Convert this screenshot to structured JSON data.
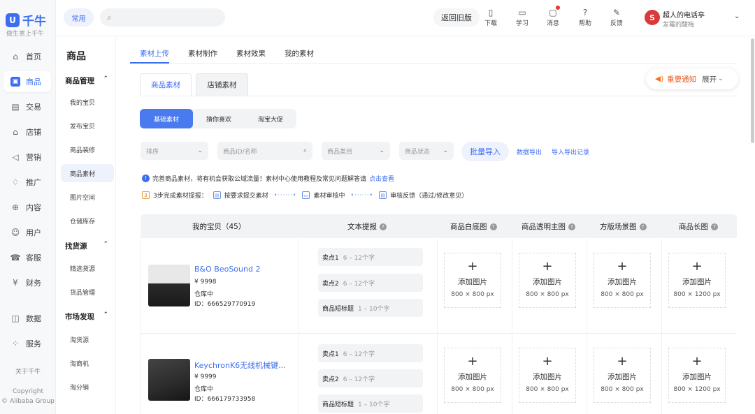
{
  "brand": {
    "name": "千牛",
    "slogan": "做生意上千牛"
  },
  "rail": [
    {
      "label": "首页",
      "icon": "home-icon"
    },
    {
      "label": "商品",
      "icon": "goods-icon",
      "active": true
    },
    {
      "label": "交易",
      "icon": "trade-icon"
    },
    {
      "label": "店铺",
      "icon": "shop-icon"
    },
    {
      "label": "营销",
      "icon": "marketing-icon"
    },
    {
      "label": "推广",
      "icon": "promote-icon"
    },
    {
      "label": "内容",
      "icon": "content-icon"
    },
    {
      "label": "用户",
      "icon": "user-icon"
    },
    {
      "label": "客服",
      "icon": "service-icon"
    },
    {
      "label": "财务",
      "icon": "finance-icon"
    },
    {
      "label": "数据",
      "icon": "data-icon"
    },
    {
      "label": "服务",
      "icon": "services-grid-icon"
    }
  ],
  "rail_footer": {
    "about": "关于千牛",
    "copyright": "Copyright",
    "company": "© Alibaba Group"
  },
  "topbar": {
    "common": "常用",
    "search_placeholder": "",
    "old_version": "返回旧版",
    "tools": [
      "下载",
      "学习",
      "消息",
      "帮助",
      "反馈"
    ],
    "user_name": "超人的电话亭",
    "user_sub": "发霉的酸梅",
    "avatar_text": "S"
  },
  "side2": {
    "title": "商品",
    "groups": [
      {
        "label": "商品管理",
        "items": [
          "我的宝贝",
          "发布宝贝",
          "商品装修",
          "商品素材",
          "图片空间",
          "仓储库存"
        ]
      },
      {
        "label": "找货源",
        "items": [
          "精选货源",
          "货品管理"
        ]
      },
      {
        "label": "市场发现",
        "items": [
          "淘货源",
          "淘商机",
          "淘分销"
        ]
      }
    ],
    "active_item": "商品素材"
  },
  "top_tabs": [
    "素材上传",
    "素材制作",
    "素材效果",
    "我的素材"
  ],
  "sub_tabs": [
    "商品素材",
    "店铺素材"
  ],
  "notice": {
    "title": "重要通知",
    "expand": "展开"
  },
  "segments": [
    "基础素材",
    "猜你喜欢",
    "淘宝大促"
  ],
  "filters": {
    "sort": "排序",
    "id": "商品ID/名称",
    "category": "商品类目",
    "status": "商品状态"
  },
  "actions": {
    "batch": "批量导入",
    "export": "数据导出",
    "record": "导入导出记录"
  },
  "tip": {
    "text": "完善商品素材，将有机会获取公域流量！素材中心使用教程及常见问题解答请",
    "link": "点击查看"
  },
  "steps": {
    "intro": "3步完成素材提报：",
    "s1": "按要求提交素材",
    "s2": "素材审核中",
    "s3": "审核反馈（通过/修改意见）"
  },
  "table": {
    "headers": [
      "我的宝贝（45）",
      "文本提报",
      "商品白底图",
      "商品透明主图",
      "方版场景图",
      "商品长图"
    ],
    "upload_label": "添加图片",
    "sizes": [
      "800 × 800 px",
      "800 × 800 px",
      "800 × 800 px",
      "800 × 1200 px"
    ],
    "text_fields": [
      {
        "label": "卖点1",
        "hint": "6 – 12个字"
      },
      {
        "label": "卖点2",
        "hint": "6 – 12个字"
      },
      {
        "label": "商品短标题",
        "hint": "1 – 10个字"
      }
    ],
    "rows": [
      {
        "name": "B&O BeoSound 2",
        "price": "¥ 9998",
        "status": "仓库中",
        "id": "ID：666529770919"
      },
      {
        "name": "KeychronK6无线机械键...",
        "price": "¥ 9999",
        "status": "仓库中",
        "id": "ID：666179733958"
      }
    ]
  }
}
